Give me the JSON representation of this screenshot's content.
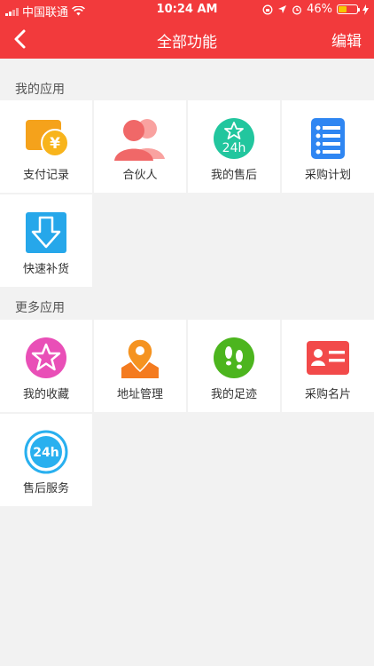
{
  "status_bar": {
    "carrier": "中国联通",
    "time": "10:24 AM",
    "battery": "46%"
  },
  "header": {
    "title": "全部功能",
    "edit_label": "编辑"
  },
  "sections": [
    {
      "label": "我的应用",
      "items": [
        {
          "label": "支付记录",
          "icon": "payment-record-icon"
        },
        {
          "label": "合伙人",
          "icon": "partner-icon"
        },
        {
          "label": "我的售后",
          "icon": "after-sales-24h-icon"
        },
        {
          "label": "采购计划",
          "icon": "purchase-plan-icon"
        },
        {
          "label": "快速补货",
          "icon": "quick-restock-icon"
        }
      ]
    },
    {
      "label": "更多应用",
      "items": [
        {
          "label": "我的收藏",
          "icon": "favorites-star-icon"
        },
        {
          "label": "地址管理",
          "icon": "address-map-icon"
        },
        {
          "label": "我的足迹",
          "icon": "footprints-icon"
        },
        {
          "label": "采购名片",
          "icon": "business-card-icon"
        },
        {
          "label": "售后服务",
          "icon": "service-24h-icon"
        }
      ]
    }
  ]
}
